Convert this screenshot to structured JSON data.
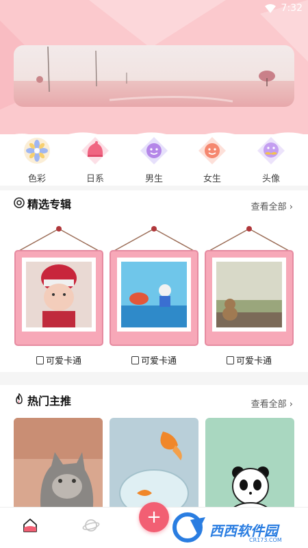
{
  "status_bar": {
    "time": "7:32"
  },
  "categories": [
    {
      "label": "色彩",
      "icon": "flower-icon"
    },
    {
      "label": "日系",
      "icon": "hat-icon"
    },
    {
      "label": "男生",
      "icon": "boy-face-icon"
    },
    {
      "label": "女生",
      "icon": "girl-face-icon"
    },
    {
      "label": "头像",
      "icon": "mustache-face-icon"
    }
  ],
  "albums_section": {
    "title": "精选专辑",
    "more": "查看全部 ›",
    "items": [
      {
        "name": "可爱卡通",
        "image": "baby-photo"
      },
      {
        "name": "可爱卡通",
        "image": "cartoon-crab-photo"
      },
      {
        "name": "可爱卡通",
        "image": "teddy-bear-photo"
      }
    ]
  },
  "hot_section": {
    "title": "热门主推",
    "more": "查看全部 ›",
    "items": [
      {
        "image": "cat-photo"
      },
      {
        "image": "goldfish-photo"
      },
      {
        "image": "panda-cartoon"
      }
    ]
  },
  "fab": {
    "label": "+"
  },
  "watermark": {
    "text": "西西软件园",
    "sub": "CR173.COM"
  },
  "colors": {
    "header_pink": "#fbc9cd",
    "accent": "#f25f73",
    "frame_pink": "#f7a8b8"
  }
}
